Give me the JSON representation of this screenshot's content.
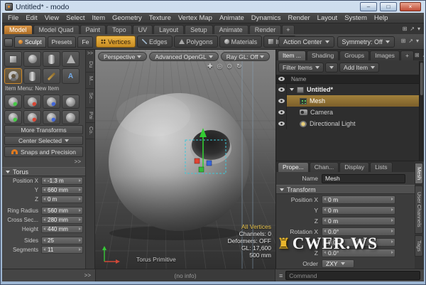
{
  "window": {
    "title": "Untitled* - modo",
    "controls": {
      "minimize": "–",
      "maximize": "□",
      "close": "×"
    }
  },
  "menubar": {
    "items": [
      "File",
      "Edit",
      "View",
      "Select",
      "Item",
      "Geometry",
      "Texture",
      "Vertex Map",
      "Animate",
      "Dynamics",
      "Render",
      "Layout",
      "System",
      "Help"
    ]
  },
  "layout_tabs": {
    "items": [
      "Model",
      "Model Quad",
      "Paint",
      "Topo",
      "UV",
      "Layout",
      "Setup",
      "Animate",
      "Render",
      "+"
    ],
    "active": "Model"
  },
  "component_tabs": {
    "items": [
      "Vertices",
      "Edges",
      "Polygons",
      "Materials",
      "Items"
    ],
    "active": "Vertices"
  },
  "toolbar": {
    "action_center": "Action Center",
    "symmetry": "Symmetry: Off"
  },
  "left_panel": {
    "tabs": {
      "sculpt": "Sculpt",
      "presets": "Presets",
      "extra": "Fe"
    },
    "vertical_tabs": [
      "Du",
      "M...",
      "Se...",
      "Pai",
      "Co."
    ],
    "item_menu": "Item Menu: New Item",
    "more_transforms": "More Transforms",
    "center_selected": "Center Selected",
    "snaps": "Snaps and Precision",
    "expand": ">>",
    "torus": {
      "title": "Torus",
      "rows": [
        {
          "label": "Position X",
          "value": "-1.3 m"
        },
        {
          "label": "Y",
          "value": "660 mm"
        },
        {
          "label": "Z",
          "value": "0 m"
        },
        {
          "label": "Ring Radius",
          "value": "560 mm"
        },
        {
          "label": "Cross Sec...",
          "value": "280 mm"
        },
        {
          "label": "Height",
          "value": "440 mm"
        },
        {
          "label": "Sides",
          "value": "25"
        },
        {
          "label": "Segments",
          "value": "11"
        }
      ]
    }
  },
  "viewport": {
    "view_type": "Perspective",
    "renderer": "Advanced OpenGL",
    "raygl": "Ray GL: Off",
    "nav_icons": [
      "✚",
      "◎",
      "⊙",
      "↻"
    ],
    "info": {
      "selection": "All Vertices",
      "channels": "Channels: 0",
      "deformers": "Deformers: OFF",
      "gl": "GL: 17,600",
      "scale": "500 mm"
    },
    "tool_label": "Torus Primitive",
    "status": "(no info)"
  },
  "item_list": {
    "tabs": [
      "Item ...",
      "Shading",
      "Groups",
      "Images",
      "+"
    ],
    "filter_label": "Filter Items",
    "add_label": "Add Item",
    "header_name": "Name",
    "rows": [
      {
        "name": "Untitled*"
      },
      {
        "name": "Mesh"
      },
      {
        "name": "Camera"
      },
      {
        "name": "Directional Light"
      }
    ]
  },
  "properties": {
    "tabs": [
      "Prope...",
      "Chan...",
      "Display",
      "Lists"
    ],
    "name_label": "Name",
    "name_value": "Mesh",
    "section": "Transform",
    "rows": [
      {
        "label": "Position X",
        "value": "0 m"
      },
      {
        "label": "Y",
        "value": "0 m"
      },
      {
        "label": "Z",
        "value": "0 m"
      },
      {
        "label": "Rotation X",
        "value": "0.0°"
      },
      {
        "label": "Y",
        "value": "0.0°"
      },
      {
        "label": "Z",
        "value": "0.0°"
      },
      {
        "label": "Order",
        "value": "ZXY"
      }
    ],
    "side_tabs": [
      "Mesh",
      "User Channels",
      "Tags"
    ]
  },
  "command_bar": {
    "grip": "≡",
    "placeholder": "Command"
  },
  "watermark": {
    "crown": "♜",
    "text": "CWER.WS"
  },
  "colors": {
    "accent_orange": "#d0912f",
    "selection_row": "#8f6f33",
    "active_tab_yellow": "#e2a93c"
  }
}
